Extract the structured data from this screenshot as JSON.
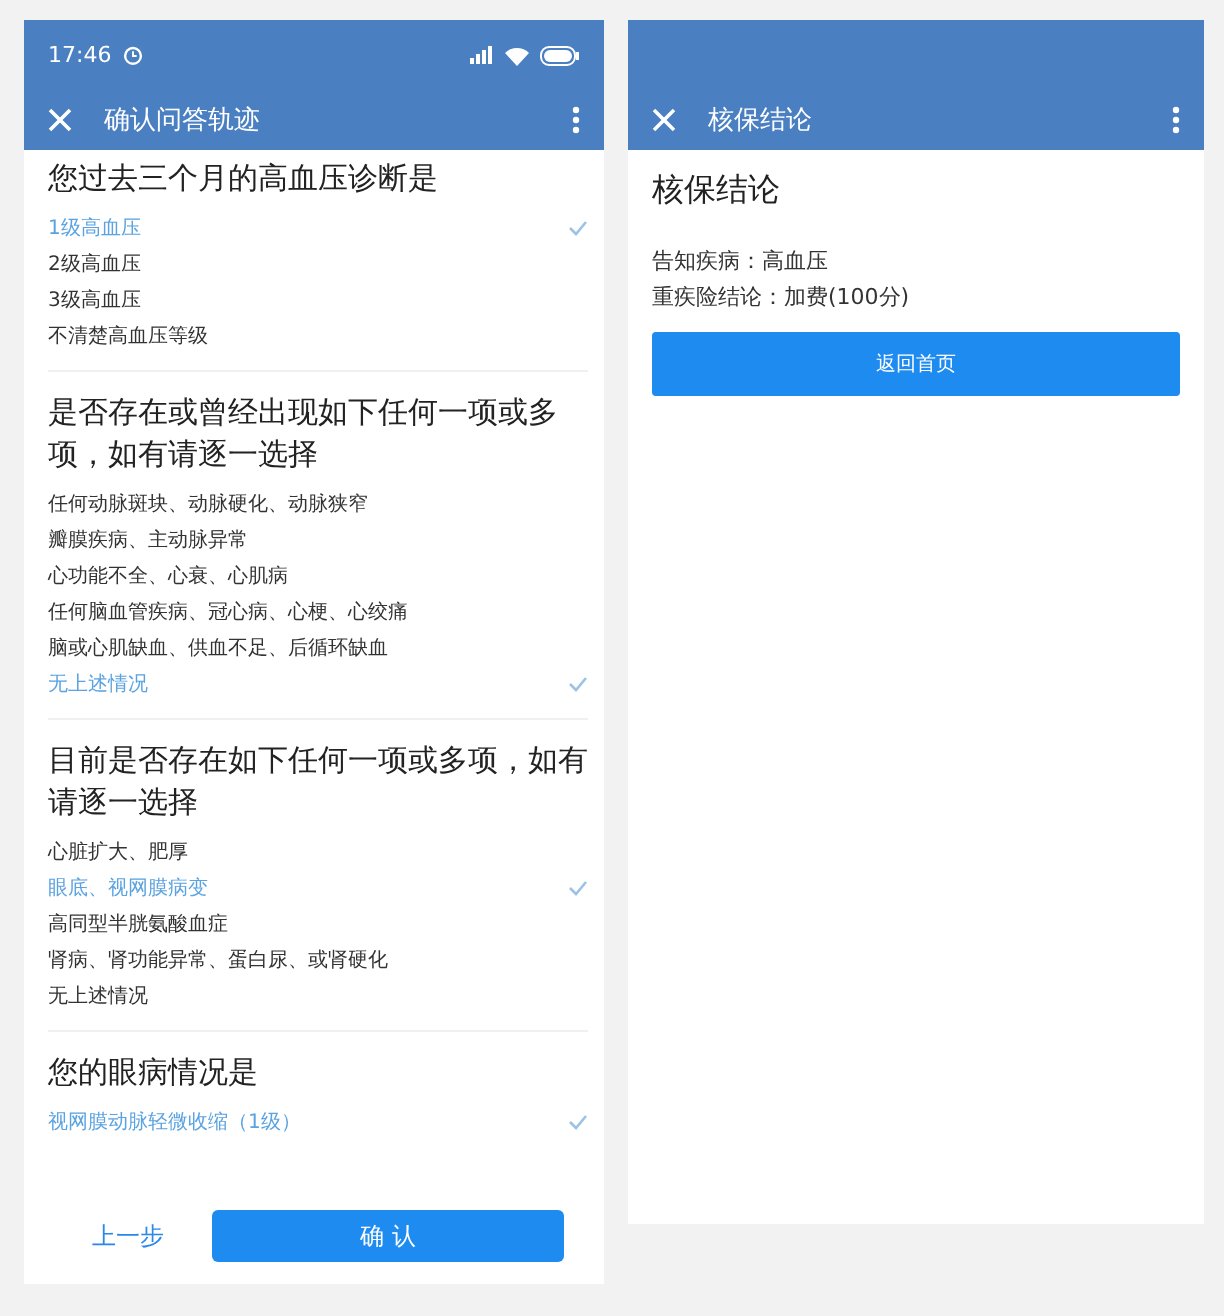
{
  "left_screen": {
    "status_bar": {
      "time": "17:46"
    },
    "title": "确认问答轨迹",
    "questions": [
      {
        "title": "您过去三个月的高血压诊断是",
        "options": [
          {
            "label": "1级高血压",
            "selected": true
          },
          {
            "label": "2级高血压",
            "selected": false
          },
          {
            "label": "3级高血压",
            "selected": false
          },
          {
            "label": "不清楚高血压等级",
            "selected": false
          }
        ]
      },
      {
        "title": "是否存在或曾经出现如下任何一项或多项，如有请逐一选择",
        "options": [
          {
            "label": "任何动脉斑块、动脉硬化、动脉狭窄",
            "selected": false
          },
          {
            "label": "瓣膜疾病、主动脉异常",
            "selected": false
          },
          {
            "label": "心功能不全、心衰、心肌病",
            "selected": false
          },
          {
            "label": "任何脑血管疾病、冠心病、心梗、心绞痛",
            "selected": false
          },
          {
            "label": "脑或心肌缺血、供血不足、后循环缺血",
            "selected": false
          },
          {
            "label": "无上述情况",
            "selected": true
          }
        ]
      },
      {
        "title": "目前是否存在如下任何一项或多项，如有请逐一选择",
        "options": [
          {
            "label": "心脏扩大、肥厚",
            "selected": false
          },
          {
            "label": "眼底、视网膜病变",
            "selected": true
          },
          {
            "label": "高同型半胱氨酸血症",
            "selected": false
          },
          {
            "label": "肾病、肾功能异常、蛋白尿、或肾硬化",
            "selected": false
          },
          {
            "label": "无上述情况",
            "selected": false
          }
        ]
      },
      {
        "title": "您的眼病情况是",
        "options": [
          {
            "label": "视网膜动脉轻微收缩（1级）",
            "selected": true
          }
        ]
      }
    ],
    "footer": {
      "back": "上一步",
      "confirm": "确 认"
    }
  },
  "right_screen": {
    "title": "核保结论",
    "heading": "核保结论",
    "lines": [
      "告知疾病：高血压",
      "重疾险结论：加费(100分)"
    ],
    "button": "返回首页"
  }
}
